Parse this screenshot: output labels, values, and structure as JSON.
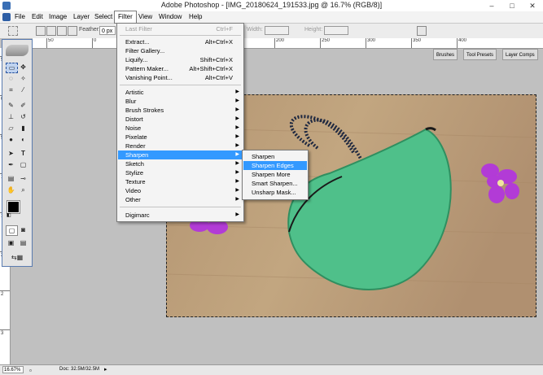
{
  "app": {
    "title": "Adobe Photoshop - [IMG_20180624_191533.jpg @ 16.7% (RGB/8)]",
    "window_buttons": [
      "–",
      "□",
      "✕"
    ]
  },
  "menubar": {
    "items": [
      "File",
      "Edit",
      "Image",
      "Layer",
      "Select",
      "Filter",
      "View",
      "Window",
      "Help"
    ],
    "active": "Filter"
  },
  "options": {
    "feather_label": "Feather:",
    "feather_value": "0 px",
    "width_label": "Width:",
    "height_label": "Height:",
    "tabs": [
      "Brushes",
      "Tool Presets",
      "Layer Comps"
    ]
  },
  "filter_menu": {
    "groups": [
      [
        {
          "label": "Last Filter",
          "shortcut": "Ctrl+F",
          "disabled": true
        }
      ],
      [
        {
          "label": "Extract...",
          "shortcut": "Alt+Ctrl+X"
        },
        {
          "label": "Filter Gallery...",
          "shortcut": ""
        },
        {
          "label": "Liquify...",
          "shortcut": "Shift+Ctrl+X"
        },
        {
          "label": "Pattern Maker...",
          "shortcut": "Alt+Shift+Ctrl+X"
        },
        {
          "label": "Vanishing Point...",
          "shortcut": "Alt+Ctrl+V"
        }
      ],
      [
        {
          "label": "Artistic",
          "submenu": true
        },
        {
          "label": "Blur",
          "submenu": true
        },
        {
          "label": "Brush Strokes",
          "submenu": true
        },
        {
          "label": "Distort",
          "submenu": true
        },
        {
          "label": "Noise",
          "submenu": true
        },
        {
          "label": "Pixelate",
          "submenu": true
        },
        {
          "label": "Render",
          "submenu": true
        },
        {
          "label": "Sharpen",
          "submenu": true,
          "highlighted": true
        },
        {
          "label": "Sketch",
          "submenu": true
        },
        {
          "label": "Stylize",
          "submenu": true
        },
        {
          "label": "Texture",
          "submenu": true
        },
        {
          "label": "Video",
          "submenu": true
        },
        {
          "label": "Other",
          "submenu": true
        }
      ],
      [
        {
          "label": "Digimarc",
          "submenu": true
        }
      ]
    ]
  },
  "sharpen_submenu": {
    "items": [
      "Sharpen",
      "Sharpen Edges",
      "Sharpen More",
      "Smart Sharpen...",
      "Unsharp Mask..."
    ],
    "highlighted": "Sharpen Edges"
  },
  "rulers": {
    "horizontal": [
      "50",
      "0",
      "50",
      "100",
      "150",
      "200",
      "250",
      "300",
      "350",
      "400"
    ],
    "vertical": [
      "5",
      "0",
      "5",
      "1",
      "1",
      "2",
      "2",
      "3"
    ]
  },
  "status": {
    "zoom": "16.67%",
    "doc": "Doc: 32.5M/32.5M"
  },
  "colors": {
    "menu_highlight": "#3399ff",
    "pouch": "#4fc08a",
    "table": "#b89a76",
    "flower": "#b23bd6"
  }
}
